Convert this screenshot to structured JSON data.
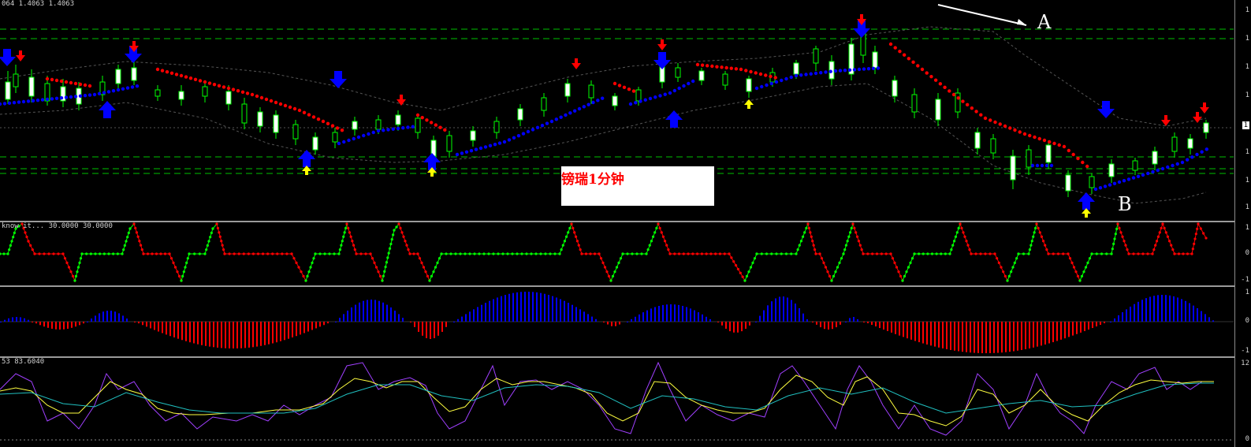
{
  "main": {
    "header": "064 1.4063 1.4063",
    "price_tag": "1",
    "axis_labels": [
      "1",
      "1",
      "1",
      "1",
      "1",
      "1",
      "1",
      "1",
      "1"
    ],
    "note": "镑瑞1分钟",
    "marker_a": "A",
    "marker_b": "B"
  },
  "pane2": {
    "header": "know it... 30.0000 30.0000",
    "axis_labels": [
      "1",
      "0",
      "-1"
    ]
  },
  "pane3": {
    "axis_labels": [
      "1",
      "0",
      "-1"
    ]
  },
  "pane4": {
    "header": "53 83.6040",
    "axis_labels": [
      "12",
      "0"
    ]
  },
  "colors": {
    "bull_candle": "#ffffff",
    "bear_candle": "#000000",
    "wick": "#00ff00",
    "psar_up": "#0000ff",
    "psar_down": "#ff0000",
    "level_lines": "#00c000",
    "signal_up": "#0000ff",
    "signal_down": "#ff0000",
    "signal_small": "#ffff00"
  }
}
